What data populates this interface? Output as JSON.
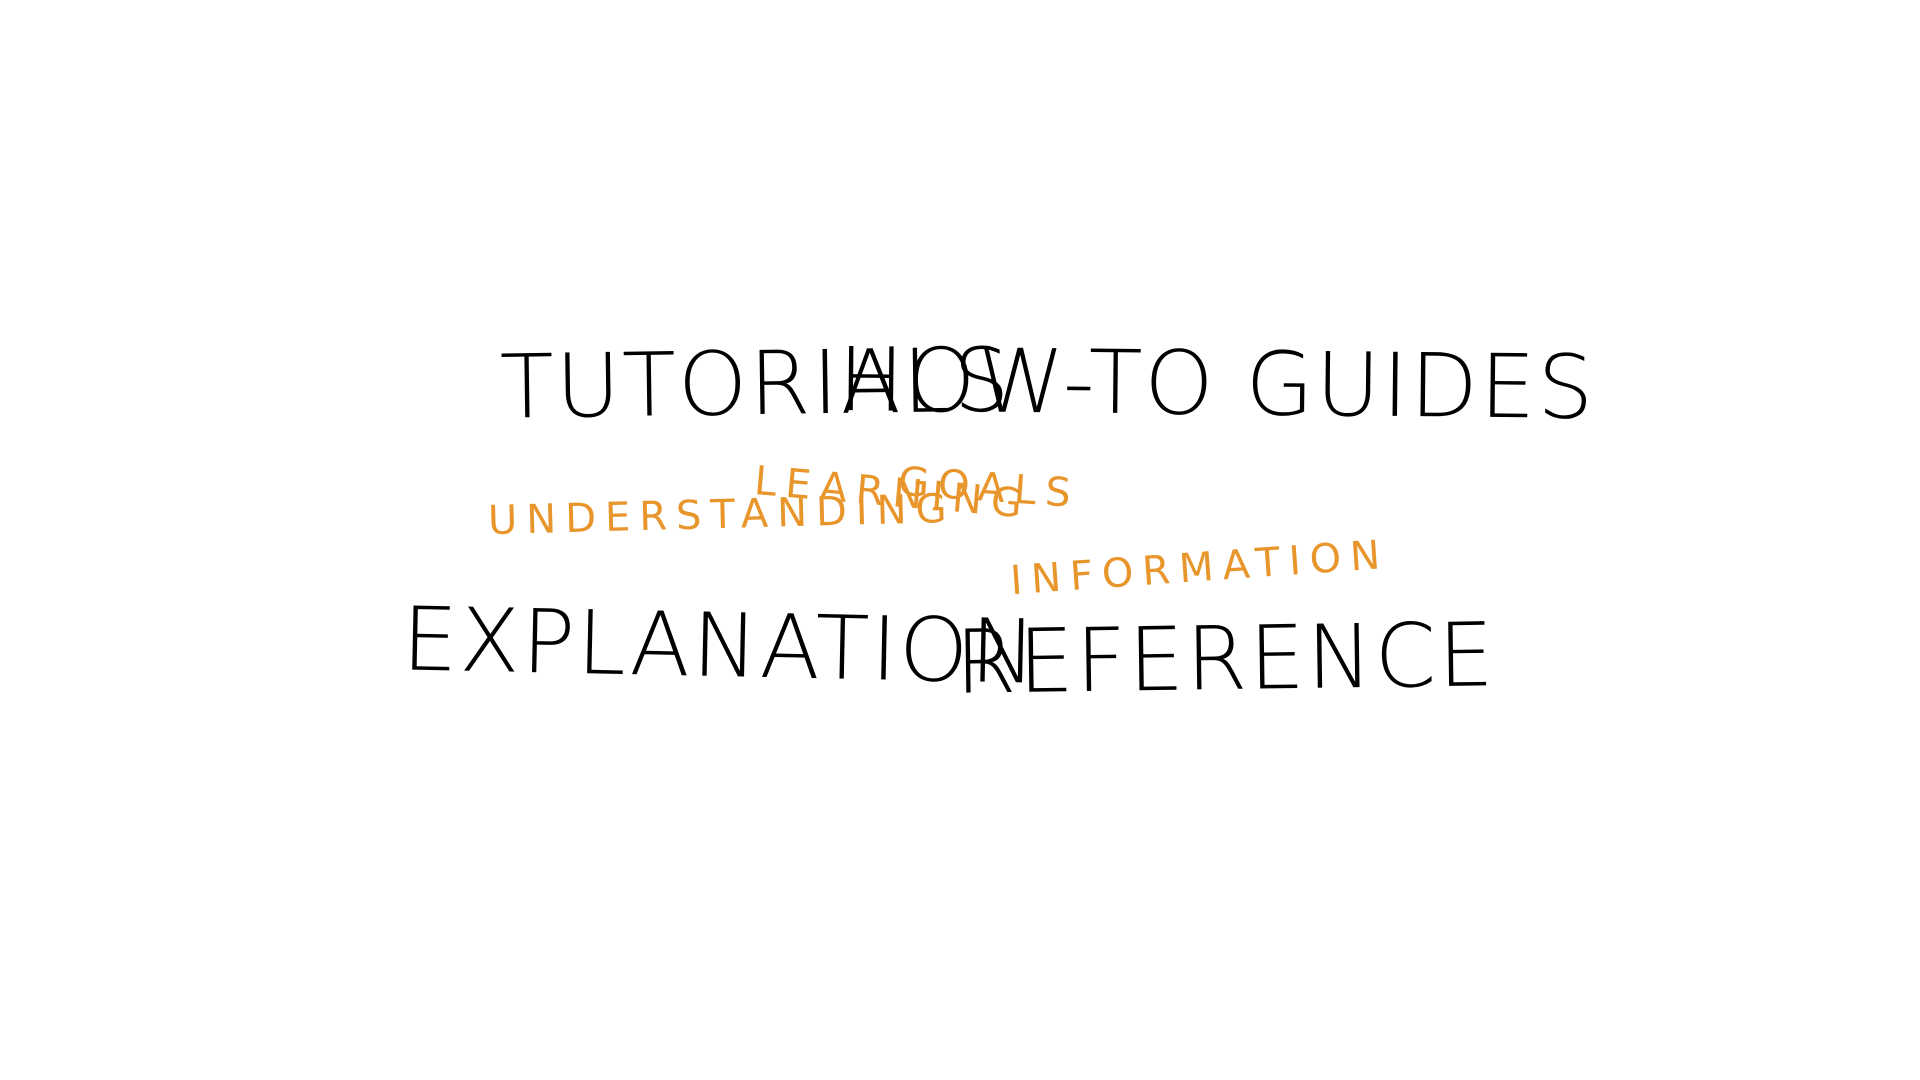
{
  "quadrants": {
    "tutorials": "TUTORIALS",
    "howto": "HOW-TO GUIDES",
    "explanation": "EXPLANATION",
    "reference": "REFERENCE"
  },
  "axes": {
    "learning": "LEARNING",
    "goals": "GOALS",
    "understanding": "UNDERSTANDING",
    "information": "INFORMATION"
  },
  "colors": {
    "heading": "#000000",
    "axis_label": "#e8962c",
    "background": "#ffffff"
  }
}
